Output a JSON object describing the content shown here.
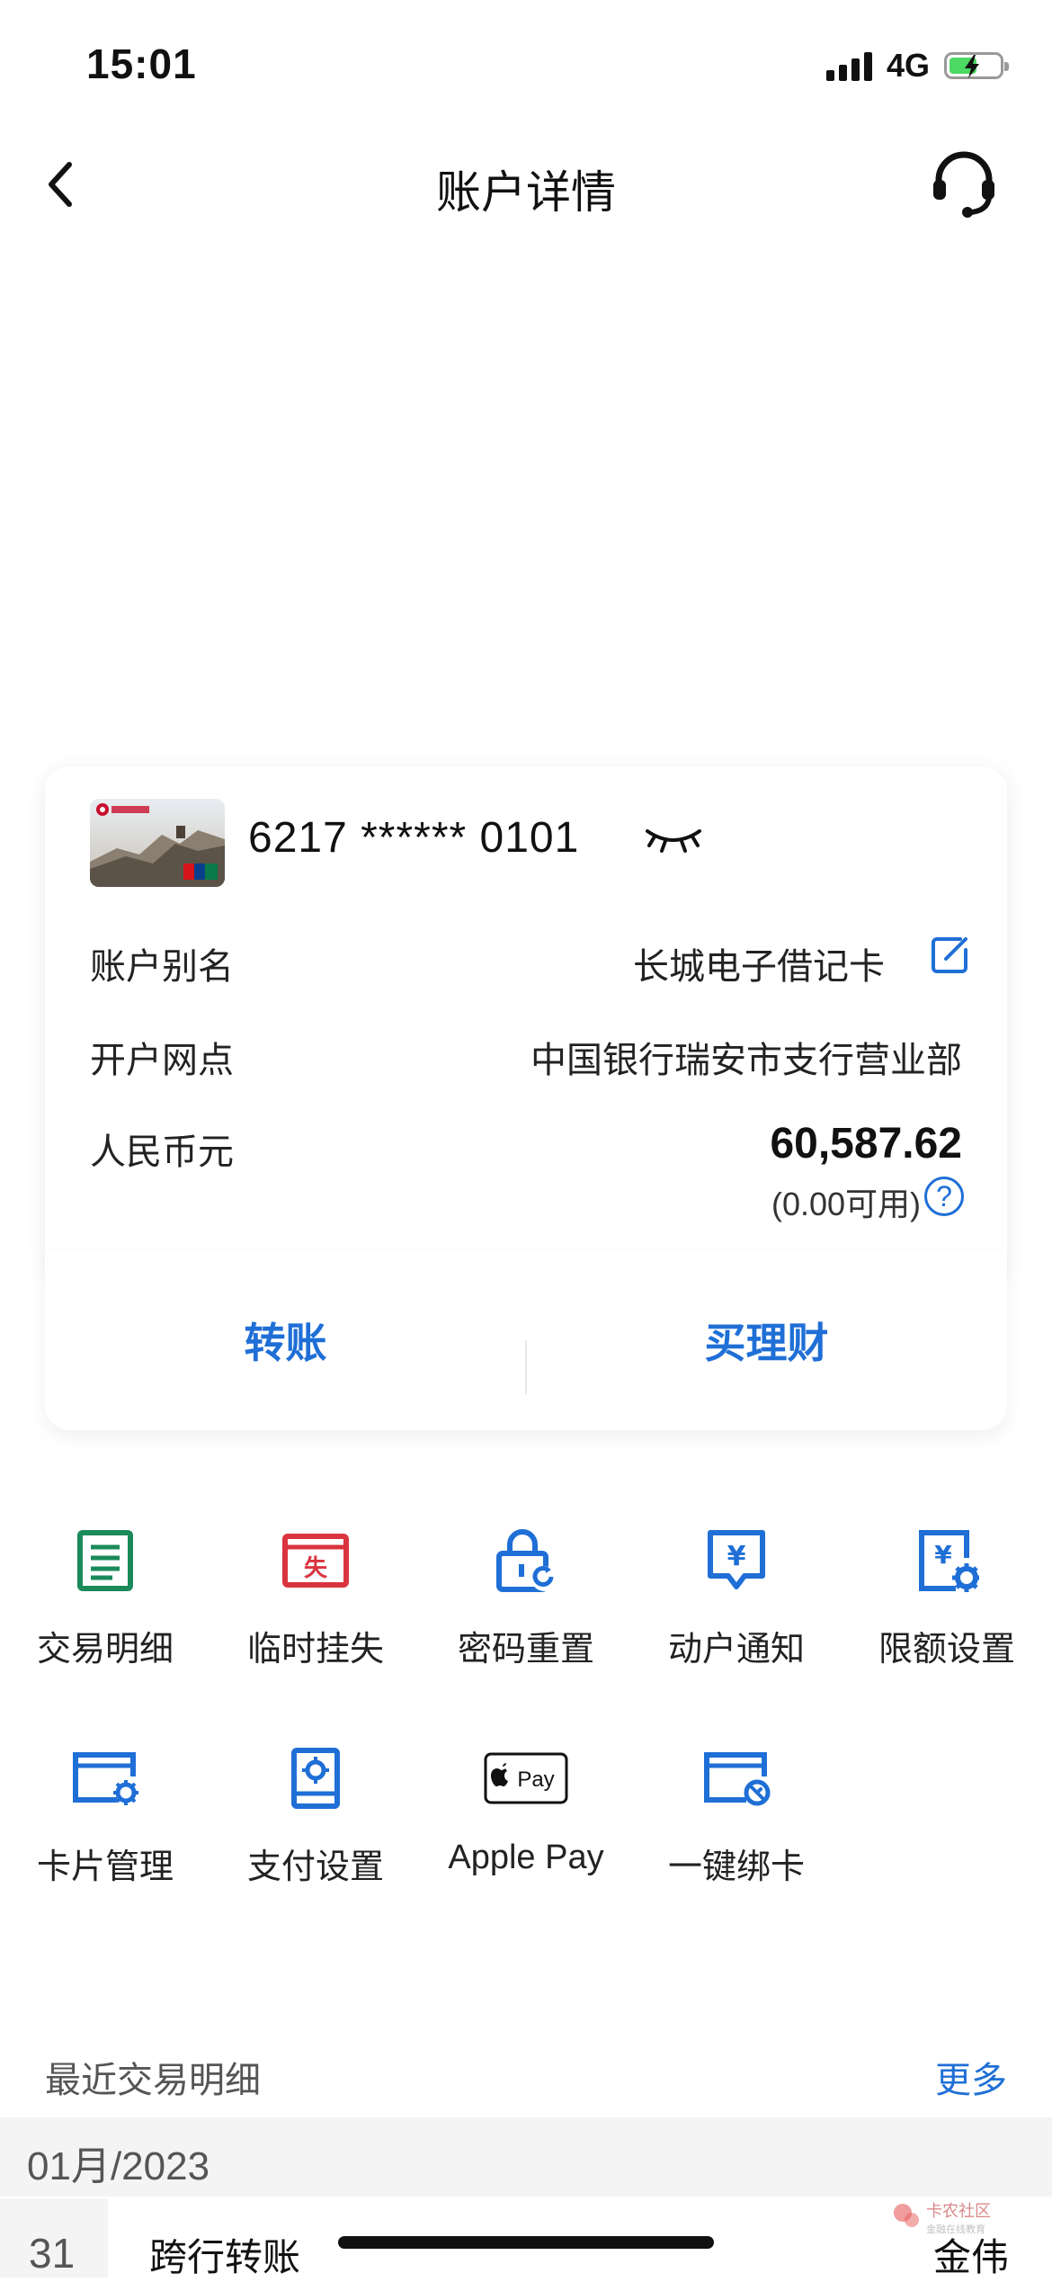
{
  "status_bar": {
    "time": "15:01",
    "network": "4G"
  },
  "nav": {
    "title": "账户详情"
  },
  "card": {
    "number": "6217 ****** 0101",
    "alias_label": "账户别名",
    "alias_value": "长城电子借记卡",
    "branch_label": "开户网点",
    "branch_value": "中国银行瑞安市支行营业部",
    "currency_label": "人民币元",
    "balance": "60,587.62",
    "available": "(0.00可用)",
    "help_symbol": "?"
  },
  "actions": {
    "transfer": "转账",
    "buy_wealth": "买理财"
  },
  "functions": [
    {
      "label": "交易明细",
      "icon": "transaction-list-icon"
    },
    {
      "label": "临时挂失",
      "icon": "report-loss-icon"
    },
    {
      "label": "密码重置",
      "icon": "password-reset-icon"
    },
    {
      "label": "动户通知",
      "icon": "account-notice-icon"
    },
    {
      "label": "限额设置",
      "icon": "limit-settings-icon"
    },
    {
      "label": "卡片管理",
      "icon": "card-management-icon"
    },
    {
      "label": "支付设置",
      "icon": "payment-settings-icon"
    },
    {
      "label": "Apple Pay",
      "icon": "apple-pay-icon"
    },
    {
      "label": "一键绑卡",
      "icon": "bind-card-icon"
    }
  ],
  "icon_text": {
    "report_loss": "失",
    "apple_pay": "Pay",
    "yuan": "¥"
  },
  "recent": {
    "title": "最近交易明细",
    "more": "更多",
    "month": "01月/2023",
    "day": "31",
    "type": "跨行转账",
    "party": "金伟"
  },
  "colors": {
    "accent": "#1f6fd6",
    "green": "#1a8a5a",
    "red": "#d9343f"
  },
  "watermark": {
    "name": "卡农社区",
    "tagline": "金融在线教育"
  }
}
